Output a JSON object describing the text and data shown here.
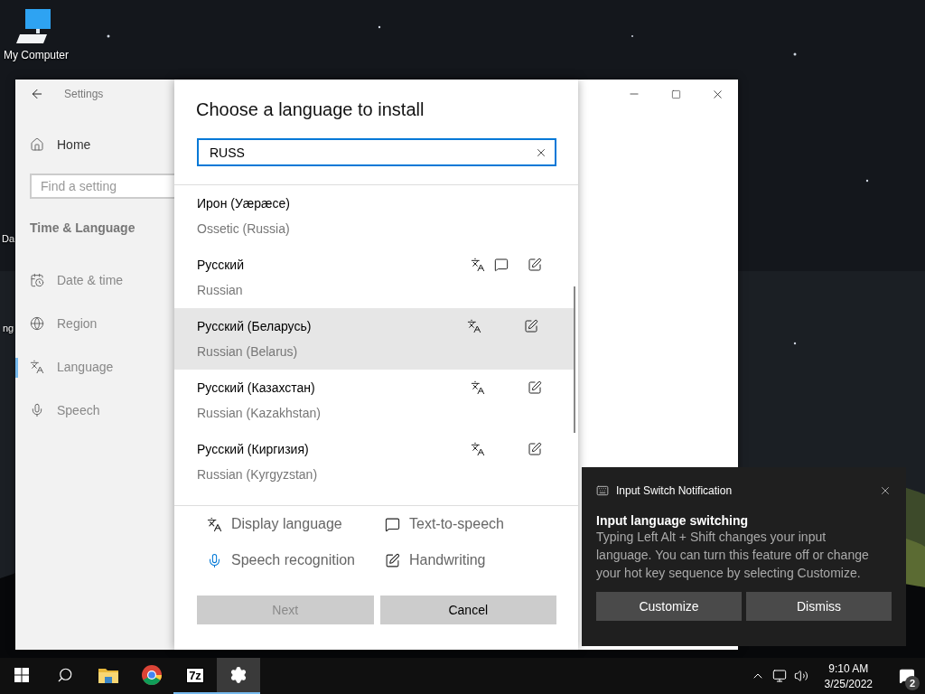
{
  "desktop": {
    "icons": [
      {
        "label": "My Computer"
      }
    ],
    "partial_labels": [
      "Da",
      "ng"
    ]
  },
  "settings": {
    "title": "Settings",
    "home": "Home",
    "search": {
      "placeholder": "Find a setting"
    },
    "section": "Time & Language",
    "nav": [
      {
        "label": "Date & time",
        "kind": "calendar",
        "selected": false
      },
      {
        "label": "Region",
        "kind": "region",
        "selected": false
      },
      {
        "label": "Language",
        "kind": "language",
        "selected": true
      },
      {
        "label": "Speech",
        "kind": "speech",
        "selected": false
      }
    ]
  },
  "dialog": {
    "title": "Choose a language to install",
    "search": {
      "value": "RUSS"
    },
    "languages": [
      {
        "name": "Ирон (Уæрæсе)",
        "english": "Ossetic (Russia)",
        "selected": false,
        "display": false,
        "tts": false,
        "handwriting": false
      },
      {
        "name": "Русский",
        "english": "Russian",
        "selected": false,
        "display": true,
        "tts": true,
        "handwriting": true
      },
      {
        "name": "Русский (Беларусь)",
        "english": "Russian (Belarus)",
        "selected": true,
        "display": true,
        "tts": false,
        "handwriting": true
      },
      {
        "name": "Русский (Казахстан)",
        "english": "Russian (Kazakhstan)",
        "selected": false,
        "display": true,
        "tts": false,
        "handwriting": true
      },
      {
        "name": "Русский (Киргизия)",
        "english": "Russian (Kyrgyzstan)",
        "selected": false,
        "display": true,
        "tts": false,
        "handwriting": true
      }
    ],
    "legend": [
      {
        "kind": "display",
        "label": "Display language"
      },
      {
        "kind": "tts",
        "label": "Text-to-speech"
      },
      {
        "kind": "speech",
        "label": "Speech recognition"
      },
      {
        "kind": "handwriting",
        "label": "Handwriting"
      }
    ],
    "buttons": [
      {
        "label": "Next",
        "disabled": true
      },
      {
        "label": "Cancel",
        "disabled": false
      }
    ]
  },
  "notification": {
    "app": "Input Switch Notification",
    "title": "Input language switching",
    "body": "Typing Left Alt + Shift changes your input language. You can turn this feature off or change your hot key sequence by selecting Customize.",
    "buttons": [
      "Customize",
      "Dismiss"
    ]
  },
  "taskbar": {
    "apps": [
      {
        "kind": "start",
        "running": false,
        "active": false
      },
      {
        "kind": "search",
        "running": false,
        "active": false
      },
      {
        "kind": "explorer",
        "running": false,
        "active": false
      },
      {
        "kind": "chrome",
        "running": false,
        "active": false
      },
      {
        "kind": "sevenzip",
        "text": "7z",
        "running": true,
        "active": false
      },
      {
        "kind": "settings",
        "running": true,
        "active": true
      }
    ],
    "time": "9:10 AM",
    "date": "3/25/2022",
    "badge": "2"
  }
}
